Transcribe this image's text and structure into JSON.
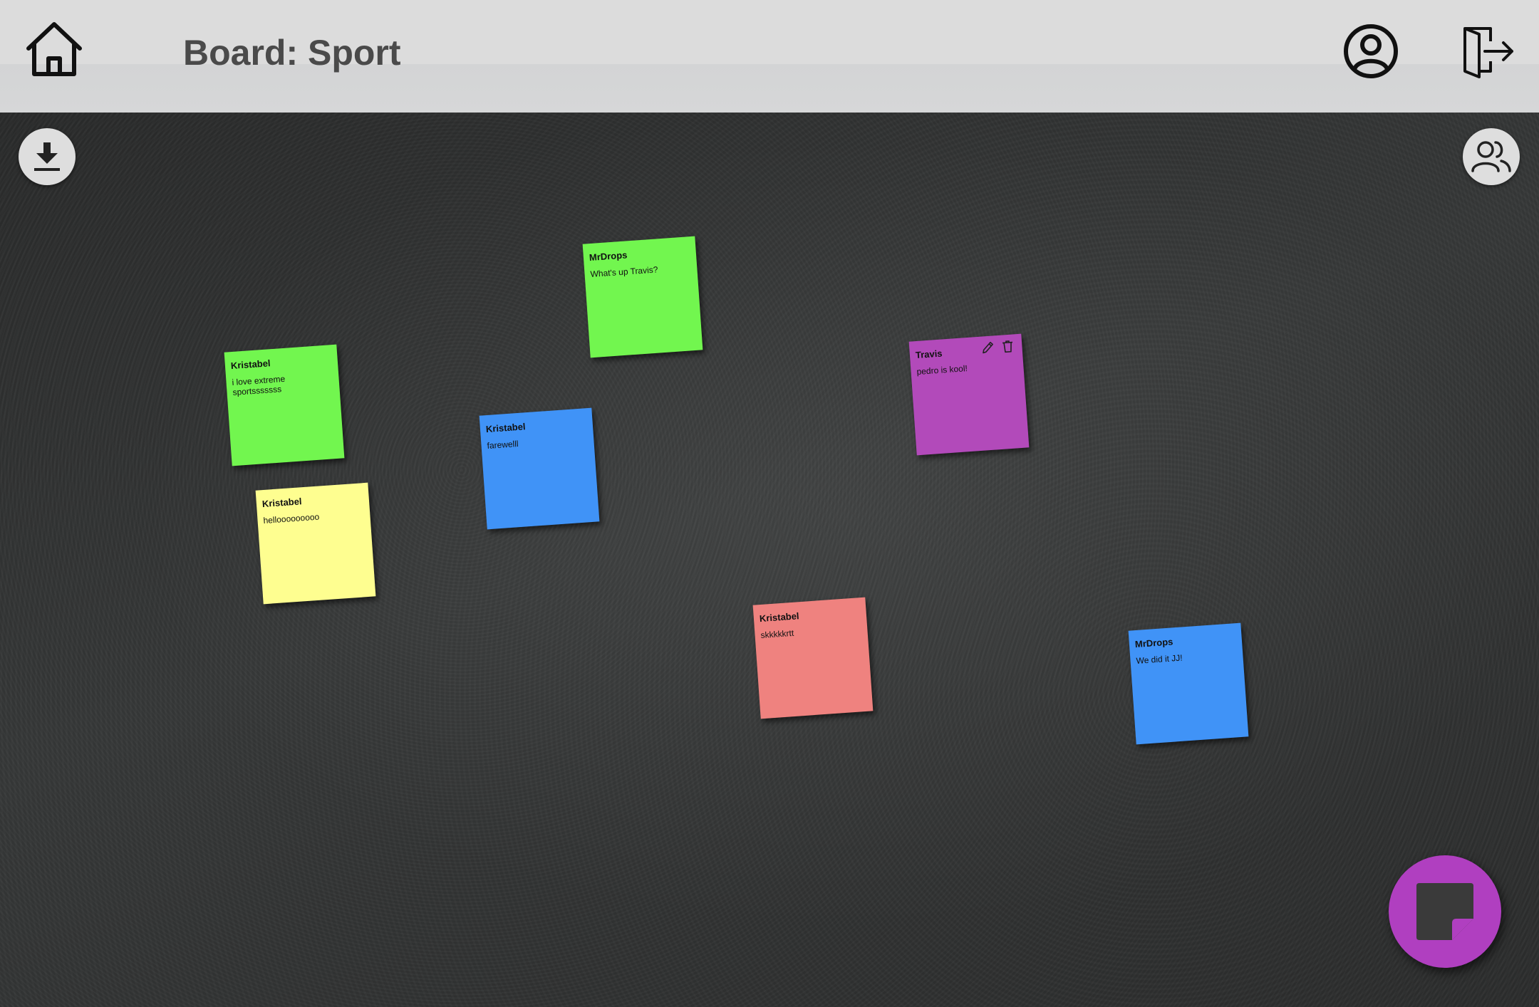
{
  "header": {
    "title": "Board: Sport",
    "home_icon": "home-icon",
    "profile_icon": "user-circle-icon",
    "logout_icon": "logout-icon"
  },
  "board": {
    "download_icon": "download-icon",
    "members_icon": "users-icon",
    "background": "dark-textured",
    "notes": [
      {
        "author": "MrDrops",
        "text": "What's up Travis?",
        "color": "#72f64f"
      },
      {
        "author": "Kristabel",
        "text": "i love extreme sportsssssss",
        "color": "#72f64f"
      },
      {
        "author": "Travis",
        "text": "pedro is kool!",
        "color": "#b24aba",
        "tools": [
          "edit-icon",
          "trash-icon"
        ]
      },
      {
        "author": "Kristabel",
        "text": "farewelll",
        "color": "#4093f7"
      },
      {
        "author": "Kristabel",
        "text": "hellooooooooo",
        "color": "#fefe90"
      },
      {
        "author": "Kristabel",
        "text": "skkkkkrtt",
        "color": "#ef827f"
      },
      {
        "author": "MrDrops",
        "text": "We did it JJ!",
        "color": "#4093f7"
      }
    ]
  },
  "fab": {
    "icon": "sticky-note-icon",
    "color": "#b03fc0"
  }
}
